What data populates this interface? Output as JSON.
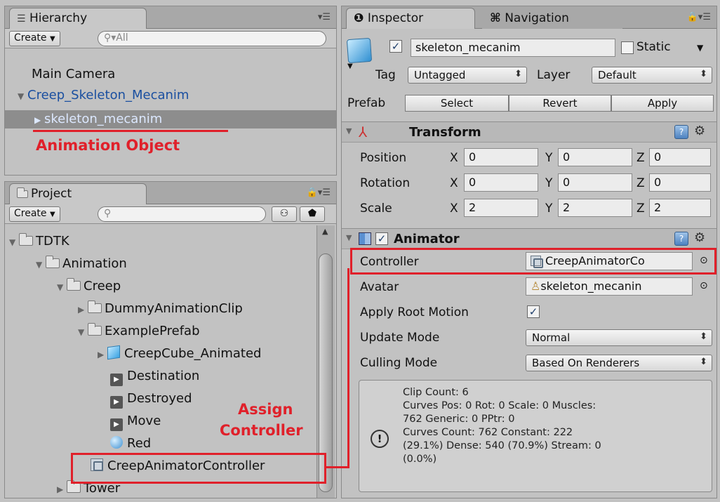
{
  "hierarchy": {
    "tab_label": "Hierarchy",
    "create_label": "Create",
    "search_placeholder": "All",
    "items": [
      {
        "label": "Main Camera"
      },
      {
        "label": "Creep_Skeleton_Mecanim"
      },
      {
        "label": "skeleton_mecanim"
      }
    ],
    "annotation": "Animation Object"
  },
  "project": {
    "tab_label": "Project",
    "create_label": "Create",
    "tree": [
      {
        "label": "TDTK"
      },
      {
        "label": "Animation"
      },
      {
        "label": "Creep"
      },
      {
        "label": "DummyAnimationClip"
      },
      {
        "label": "ExamplePrefab"
      },
      {
        "label": "CreepCube_Animated"
      },
      {
        "label": "Destination"
      },
      {
        "label": "Destroyed"
      },
      {
        "label": "Move"
      },
      {
        "label": "Red"
      },
      {
        "label": "CreepAnimatorController"
      },
      {
        "label": "Tower"
      }
    ],
    "annotation_line1": "Assign",
    "annotation_line2": "Controller"
  },
  "inspector": {
    "tab_label": "Inspector",
    "nav_tab_label": "Navigation",
    "object_name": "skeleton_mecanim",
    "static_label": "Static",
    "tag_label": "Tag",
    "tag_value": "Untagged",
    "layer_label": "Layer",
    "layer_value": "Default",
    "prefab_label": "Prefab",
    "prefab_buttons": {
      "select": "Select",
      "revert": "Revert",
      "apply": "Apply"
    },
    "transform": {
      "title": "Transform",
      "rows": [
        {
          "label": "Position",
          "x": "0",
          "y": "0",
          "z": "0"
        },
        {
          "label": "Rotation",
          "x": "0",
          "y": "0",
          "z": "0"
        },
        {
          "label": "Scale",
          "x": "2",
          "y": "2",
          "z": "2"
        }
      ],
      "axis_x": "X",
      "axis_y": "Y",
      "axis_z": "Z"
    },
    "animator": {
      "title": "Animator",
      "controller_label": "Controller",
      "controller_value": "CreepAnimatorCo",
      "avatar_label": "Avatar",
      "avatar_value": "skeleton_mecanin",
      "root_motion_label": "Apply Root Motion",
      "update_mode_label": "Update Mode",
      "update_mode_value": "Normal",
      "culling_mode_label": "Culling Mode",
      "culling_mode_value": "Based On Renderers",
      "info_text": "Clip Count: 6\nCurves Pos: 0 Rot: 0 Scale: 0 Muscles:\n762 Generic: 0 PPtr: 0\nCurves Count: 762 Constant: 222\n(29.1%) Dense: 540 (70.9%) Stream: 0\n(0.0%)"
    }
  },
  "colors": {
    "annotation": "#e0202a",
    "selection": "#8d8d8d",
    "hierarchy_link": "#1a4fa0"
  }
}
